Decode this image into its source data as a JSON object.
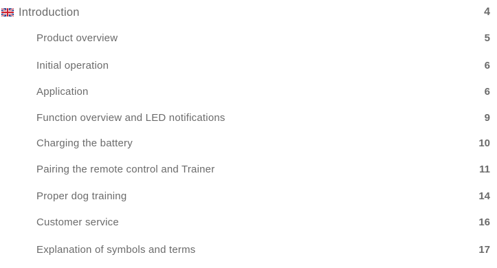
{
  "toc": {
    "flag_icon": "uk-flag-icon",
    "colors": {
      "text": "#6b6b6b",
      "flag_blue": "#1f3a8a",
      "flag_red": "#d0202e"
    },
    "entries": [
      {
        "title": "Introduction",
        "page": "4"
      },
      {
        "title": "Product overview",
        "page": "5"
      },
      {
        "title": "Initial operation",
        "page": "6"
      },
      {
        "title": "Application",
        "page": "6"
      },
      {
        "title": "Function overview and LED notifications",
        "page": "9"
      },
      {
        "title": "Charging the battery",
        "page": "10"
      },
      {
        "title": "Pairing the remote control and Trainer",
        "page": "11"
      },
      {
        "title": "Proper dog training",
        "page": "14"
      },
      {
        "title": "Customer service",
        "page": "16"
      },
      {
        "title": "Explanation of symbols and terms",
        "page": "17"
      }
    ]
  }
}
